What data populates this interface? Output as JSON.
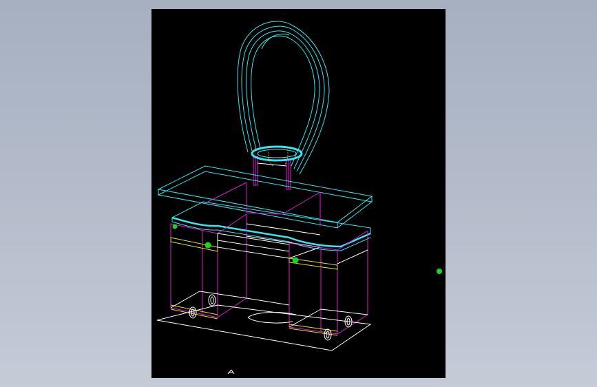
{
  "colors": {
    "background": "#000000",
    "cyan": "#34e7f0",
    "magenta": "#e41ad4",
    "white": "#ffffff",
    "yellow": "#e6e226",
    "green": "#19d51e",
    "orange": "#e3951d"
  },
  "icons": {
    "ucs": "ucs-icon",
    "grip": "grip-marker-icon"
  }
}
